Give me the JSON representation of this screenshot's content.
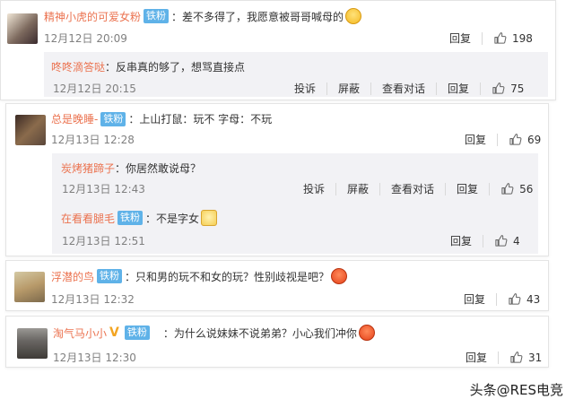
{
  "comments": [
    {
      "user": "精神小虎的可爱女粉",
      "badge": "铁粉",
      "text": "：差不多得了，我愿意被哥哥喊母的",
      "time": "12月12日 20:09",
      "reply_label": "回复",
      "likes": "198",
      "replies": [
        {
          "user": "咚咚滴答哒",
          "text": "：反串真的够了，想骂直接点",
          "time": "12月12日 20:15",
          "report_label": "投诉",
          "block_label": "屏蔽",
          "view_label": "查看对话",
          "reply_label": "回复",
          "likes": "75"
        }
      ]
    },
    {
      "user": "总是晚睡-",
      "badge": "铁粉",
      "text": "：上山打鼠：玩不 字母：不玩",
      "time": "12月13日 12:28",
      "reply_label": "回复",
      "likes": "69",
      "replies": [
        {
          "user": "炭烤猪蹄子",
          "text": "：你居然敢说母？",
          "time": "12月13日 12:43",
          "report_label": "投诉",
          "block_label": "屏蔽",
          "view_label": "查看对话",
          "reply_label": "回复",
          "likes": "56"
        },
        {
          "user": "在看看腿毛",
          "badge": "铁粉",
          "text": "：不是字女",
          "time": "12月13日 12:51",
          "reply_label": "回复",
          "likes": "4"
        }
      ]
    },
    {
      "user": "浮潜的鸟",
      "badge": "铁粉",
      "text": "：只和男的玩不和女的玩？性别歧视是吧？",
      "time": "12月13日 12:32",
      "reply_label": "回复",
      "likes": "43"
    },
    {
      "user": "淘气马小小",
      "badge": "铁粉",
      "vbadge": "V",
      "text": "：为什么说妹妹不说弟弟？小心我们冲你",
      "time": "12月13日 12:30",
      "reply_label": "回复",
      "likes": "31"
    }
  ],
  "watermark": "头条@RES电竞",
  "colors": {
    "username": "#eb7350",
    "badge_bg": "#5fb2e8",
    "reply_bg": "#f2f2f5",
    "time": "#808080"
  },
  "icons": [
    "thumbs-up-icon",
    "blush-emoji-icon",
    "angry-emoji-icon",
    "grin-emoji-icon"
  ]
}
